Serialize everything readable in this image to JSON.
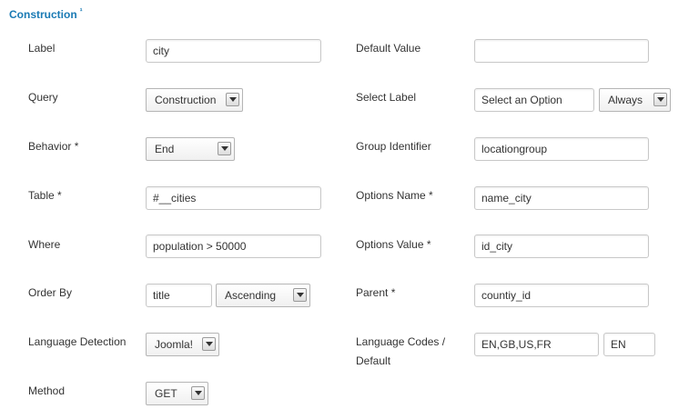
{
  "section": {
    "title": "Construction",
    "marker": "¹"
  },
  "left": {
    "label": {
      "label": "Label",
      "value": "city"
    },
    "query": {
      "label": "Query",
      "value": "Construction"
    },
    "behavior": {
      "label": "Behavior *",
      "value": "End"
    },
    "table": {
      "label": "Table *",
      "value": "#__cities"
    },
    "where": {
      "label": "Where",
      "value": "population > 50000"
    },
    "order_by": {
      "label": "Order By",
      "value": "title",
      "direction": "Ascending"
    },
    "language_detection": {
      "label": "Language Detection",
      "value": "Joomla!"
    },
    "method": {
      "label": "Method",
      "value": "GET"
    }
  },
  "right": {
    "default_value": {
      "label": "Default Value",
      "value": ""
    },
    "select_label": {
      "label": "Select Label",
      "value": "Select an Option",
      "mode": "Always"
    },
    "group_identifier": {
      "label": "Group Identifier",
      "value": "locationgroup"
    },
    "options_name": {
      "label": "Options Name *",
      "value": "name_city"
    },
    "options_value": {
      "label": "Options Value *",
      "value": "id_city"
    },
    "parent": {
      "label": "Parent *",
      "value": "countiy_id"
    },
    "language_codes": {
      "label_line1": "Language Codes /",
      "label_line2": "Default",
      "codes": "EN,GB,US,FR",
      "default": "EN"
    }
  }
}
